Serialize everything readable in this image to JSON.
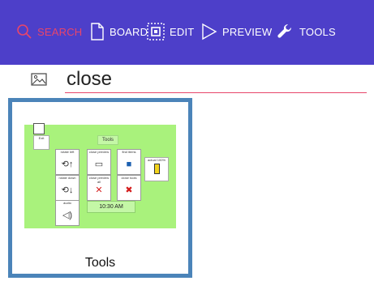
{
  "toolbar": {
    "search_label": "SEARCH",
    "board_label": "BOARD",
    "edit_label": "EDIT",
    "preview_label": "PREVIEW",
    "tools_label": "TOOLS",
    "background_color": "#4d3fc9",
    "active_color": "#e8456a",
    "icons": [
      "search-icon",
      "board-icon",
      "edit-icon",
      "preview-icon",
      "wrench-icon"
    ]
  },
  "search": {
    "value": "close",
    "icon": "image-icon",
    "underline_color": "#e8456a"
  },
  "results": [
    {
      "label": "Tools",
      "border_color": "#4b84b9",
      "preview": {
        "title": "Tools",
        "background_color": "#a9f27c",
        "exit_label": "Exit",
        "buttons": [
          {
            "label": "rotate left",
            "icon": "rotate-icon"
          },
          {
            "label": "close preview",
            "icon": "speech-bubble-icon"
          },
          {
            "label": "find items",
            "icon": "computer-icon"
          },
          {
            "label": "rotate down",
            "icon": "rotate-down-icon"
          },
          {
            "label": "close preview all",
            "icon": "x-icon"
          },
          {
            "label": "close tools",
            "icon": "x-red-icon"
          },
          {
            "label": "audio",
            "icon": "speaker-icon"
          }
        ],
        "zoom_label": "actual 100%",
        "time": "10:30 AM"
      }
    }
  ]
}
